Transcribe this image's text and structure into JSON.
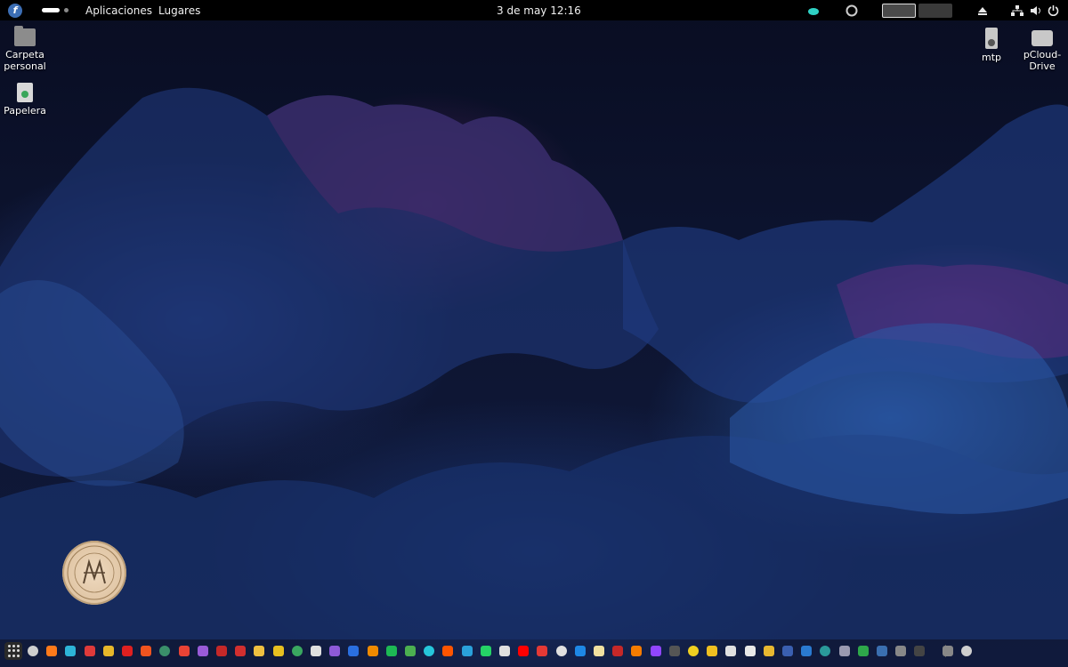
{
  "topbar": {
    "os_logo": "f",
    "menu_applications": "Aplicaciones",
    "menu_places": "Lugares",
    "clock": "3 de may  12:16",
    "tray_icons": [
      "cloud-icon",
      "sync-icon",
      "window-preview",
      "window-preview",
      "eject-icon",
      "network-icon",
      "volume-icon",
      "power-icon"
    ]
  },
  "desktop_icons": {
    "home": {
      "label_line1": "Carpeta",
      "label_line2": "personal",
      "icon": "home-folder-icon"
    },
    "trash": {
      "label": "Papelera",
      "icon": "trash-icon"
    },
    "mtp": {
      "label": "mtp",
      "icon": "media-player-icon"
    },
    "pcloud": {
      "label_line1": "pCloud-",
      "label_line2": "Drive",
      "icon": "drive-icon"
    }
  },
  "seal": {
    "center_text": "HVA",
    "ring_text": "HUMBERTO VILLAFUERTE ÁLVAREZ"
  },
  "dock": {
    "apps": [
      {
        "name": "app-grid-icon"
      },
      {
        "name": "obs-icon",
        "color": "#cfcfcf"
      },
      {
        "name": "firefox-icon",
        "color": "#ff7a1a"
      },
      {
        "name": "edge-icon",
        "color": "#2db4d8"
      },
      {
        "name": "vivaldi-icon",
        "color": "#e03a3a"
      },
      {
        "name": "chrome-icon",
        "color": "#e8b82a"
      },
      {
        "name": "opera-icon",
        "color": "#e02020"
      },
      {
        "name": "brave-icon",
        "color": "#f0541f"
      },
      {
        "name": "app-icon",
        "color": "#3a8f6a"
      },
      {
        "name": "gmail-icon",
        "color": "#ea4335"
      },
      {
        "name": "mail-icon",
        "color": "#9a5bd8"
      },
      {
        "name": "app-icon",
        "color": "#c62828"
      },
      {
        "name": "typora-icon",
        "color": "#d32f2f"
      },
      {
        "name": "notes-icon",
        "color": "#f0c040"
      },
      {
        "name": "app-icon",
        "color": "#e8c020"
      },
      {
        "name": "app-icon",
        "color": "#3aa860"
      },
      {
        "name": "play-icon",
        "color": "#e0e0e0"
      },
      {
        "name": "app-icon",
        "color": "#8e5ad8"
      },
      {
        "name": "app-icon",
        "color": "#2a6fe0"
      },
      {
        "name": "vlc-icon",
        "color": "#f08a00"
      },
      {
        "name": "spotify-icon",
        "color": "#1db954"
      },
      {
        "name": "app-icon",
        "color": "#4caf50"
      },
      {
        "name": "app-icon",
        "color": "#26c6da"
      },
      {
        "name": "soundcloud-icon",
        "color": "#ff5500"
      },
      {
        "name": "telegram-icon",
        "color": "#2aa1da"
      },
      {
        "name": "whatsapp-icon",
        "color": "#25d366"
      },
      {
        "name": "tiktok-icon",
        "color": "#e0e0e0"
      },
      {
        "name": "youtube-icon",
        "color": "#ff0000"
      },
      {
        "name": "app-icon",
        "color": "#e53935"
      },
      {
        "name": "m-icon",
        "color": "#e0e0e0"
      },
      {
        "name": "app-icon",
        "color": "#1e88e5"
      },
      {
        "name": "app-icon",
        "color": "#f0e0a0"
      },
      {
        "name": "app-icon",
        "color": "#c62828"
      },
      {
        "name": "app-icon",
        "color": "#f57c00"
      },
      {
        "name": "twitch-icon",
        "color": "#9146ff"
      },
      {
        "name": "app-icon",
        "color": "#555555"
      },
      {
        "name": "app-icon",
        "color": "#f0d020"
      },
      {
        "name": "app-icon",
        "color": "#f0c020"
      },
      {
        "name": "app-icon",
        "color": "#e0e0e0"
      },
      {
        "name": "app-icon",
        "color": "#e8e8e8"
      },
      {
        "name": "app-icon",
        "color": "#e8b830"
      },
      {
        "name": "app-icon",
        "color": "#3a5fb0"
      },
      {
        "name": "app-icon",
        "color": "#2a7ad0"
      },
      {
        "name": "app-icon",
        "color": "#2a9a9a"
      },
      {
        "name": "folder-icon",
        "color": "#9a9ab0"
      },
      {
        "name": "app-icon",
        "color": "#2ea84a"
      },
      {
        "name": "app-icon",
        "color": "#3a6fb0"
      },
      {
        "name": "app-icon",
        "color": "#888888"
      },
      {
        "name": "terminal-icon",
        "color": "#444444"
      },
      {
        "name": "phone-icon",
        "color": "#888888"
      },
      {
        "name": "trash-icon",
        "color": "#cfcfcf"
      }
    ]
  }
}
